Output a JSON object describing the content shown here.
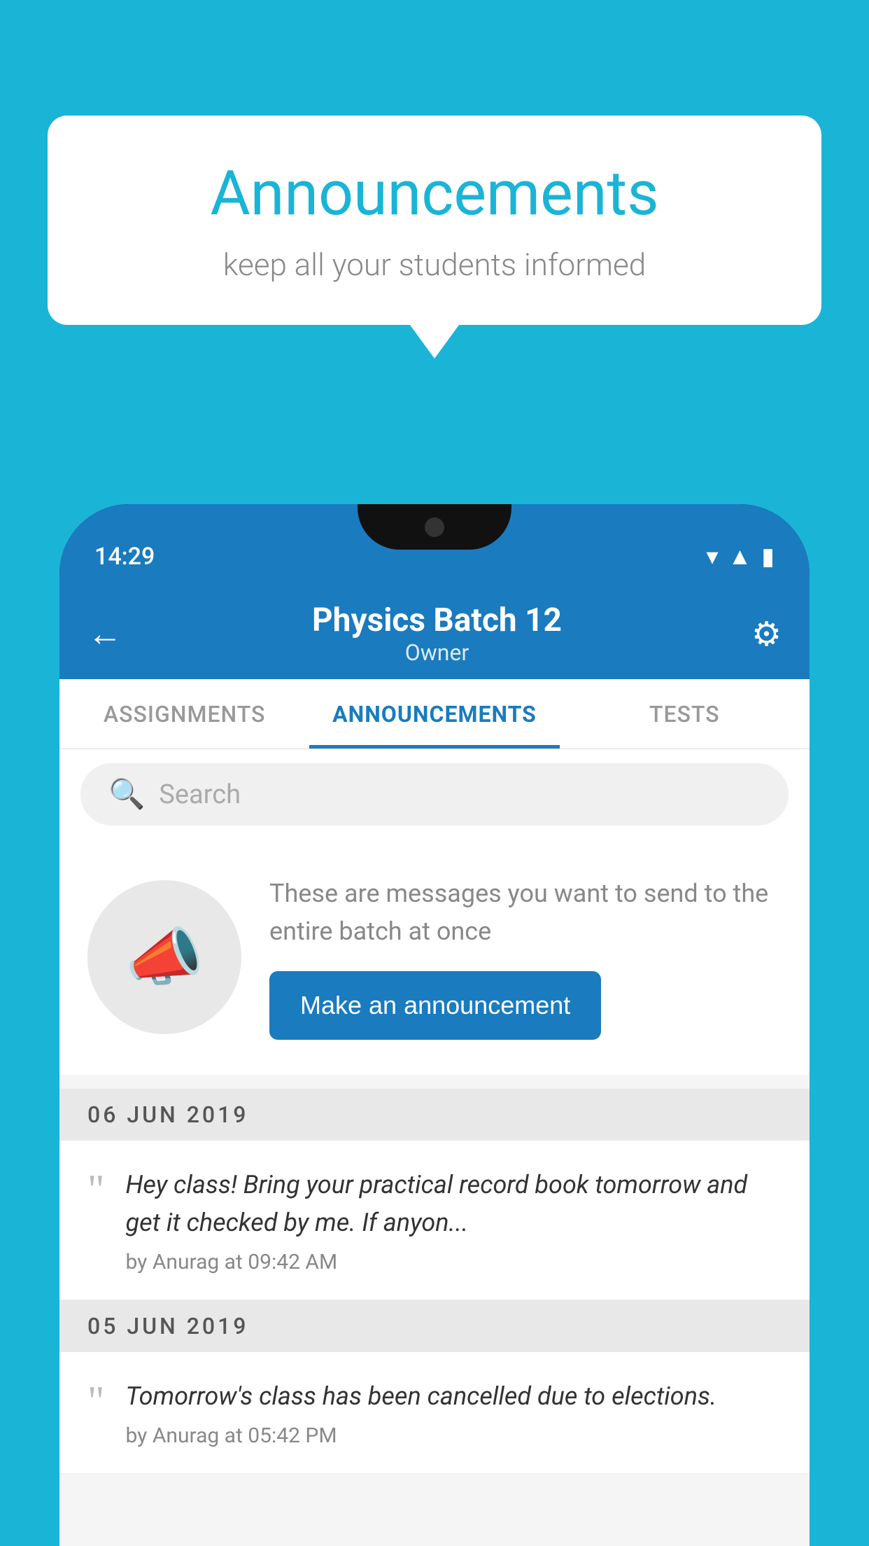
{
  "background_color": "#1ab4d7",
  "speech_bubble": {
    "title": "Announcements",
    "subtitle": "keep all your students informed"
  },
  "status_bar": {
    "time": "14:29",
    "icons": [
      "wifi",
      "signal",
      "battery"
    ]
  },
  "app_bar": {
    "title": "Physics Batch 12",
    "subtitle": "Owner",
    "back_label": "←",
    "gear_label": "⚙"
  },
  "tabs": [
    {
      "label": "ASSIGNMENTS",
      "active": false
    },
    {
      "label": "ANNOUNCEMENTS",
      "active": true
    },
    {
      "label": "TESTS",
      "active": false
    }
  ],
  "search": {
    "placeholder": "Search"
  },
  "empty_state": {
    "message": "These are messages you want to send to the entire batch at once",
    "button_label": "Make an announcement"
  },
  "date_sections": [
    {
      "date": "06  JUN  2019",
      "announcements": [
        {
          "text": "Hey class! Bring your practical record book tomorrow and get it checked by me. If anyon...",
          "meta": "by Anurag at 09:42 AM"
        }
      ]
    },
    {
      "date": "05  JUN  2019",
      "announcements": [
        {
          "text": "Tomorrow's class has been cancelled due to elections.",
          "meta": "by Anurag at 05:42 PM"
        }
      ]
    }
  ]
}
